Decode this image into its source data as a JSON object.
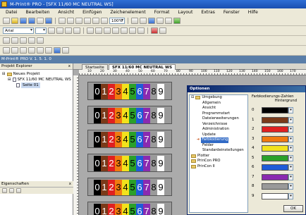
{
  "window": {
    "title": "M-Print® PRO - [SFX 11/60 MC NEUTRAL WS]"
  },
  "menu": [
    "Datei",
    "Bearbeiten",
    "Ansicht",
    "Einfügen",
    "Zeichenelement",
    "Format",
    "Layout",
    "Extras",
    "Fenster",
    "Hilfe"
  ],
  "toolbar": {
    "zoom": "100%",
    "font": "Arial"
  },
  "version": "M-Print® PRO V. 1. 5. 1. 0",
  "project_explorer": {
    "title": "Projekt Explorer",
    "close": "x",
    "items": [
      "Neues Projekt",
      "SFX 11/60 MC NEUTRAL WS",
      "Seite 01"
    ]
  },
  "properties": {
    "title": "Eigenschaften",
    "close": "x"
  },
  "tabs": [
    {
      "label": "Startseite"
    },
    {
      "label": "SFX 11/60 MC NEUTRAL WS"
    }
  ],
  "ruler": [
    "10",
    "20",
    "30",
    "40",
    "50",
    "60",
    "70",
    "80",
    "90",
    "100",
    "110",
    "120",
    "130",
    "140",
    "150",
    "160",
    "170"
  ],
  "label_digits": [
    "0",
    "1",
    "2",
    "3",
    "4",
    "5",
    "6",
    "7",
    "8",
    "9"
  ],
  "digit_colors": [
    {
      "bg": "#000000",
      "fg": "#ffffff"
    },
    {
      "bg": "#7a3a1a",
      "fg": "#ffffff"
    },
    {
      "bg": "#e02020",
      "fg": "#ffffff"
    },
    {
      "bg": "#f07a10",
      "fg": "#000000"
    },
    {
      "bg": "#f2e21c",
      "fg": "#000000"
    },
    {
      "bg": "#2aa02a",
      "fg": "#000000"
    },
    {
      "bg": "#1e5bd8",
      "fg": "#ffffff"
    },
    {
      "bg": "#8a2ab0",
      "fg": "#ffffff"
    },
    {
      "bg": "#9a9a9a",
      "fg": "#000000"
    },
    {
      "bg": "#ffffff",
      "fg": "#000000"
    }
  ],
  "dialog": {
    "title": "Optionen",
    "tree": [
      "Umgebung",
      "Allgemein",
      "Ansicht",
      "Programmstart",
      "Dateierweiterungen",
      "Verzeichnisse",
      "Administration",
      "Update",
      "Farbkodierung",
      "Felder",
      "Standardeinstellungen",
      "Plotter",
      "PrinCon PRO",
      "PrinCon II"
    ],
    "panel_title": "Farbkodierungs-Zahlen",
    "panel_sub": "Hintergrund",
    "rows": [
      {
        "index": "0",
        "color": "#000000"
      },
      {
        "index": "1",
        "color": "#7a3a1a"
      },
      {
        "index": "2",
        "color": "#e02020"
      },
      {
        "index": "3",
        "color": "#f07a10"
      },
      {
        "index": "4",
        "color": "#f2e21c"
      },
      {
        "index": "5",
        "color": "#2aa02a"
      },
      {
        "index": "6",
        "color": "#1e5bd8"
      },
      {
        "index": "7",
        "color": "#8a2ab0"
      },
      {
        "index": "8",
        "color": "#9a9a9a"
      },
      {
        "index": "9",
        "color": "#ffffff"
      }
    ],
    "ok": "OK"
  }
}
